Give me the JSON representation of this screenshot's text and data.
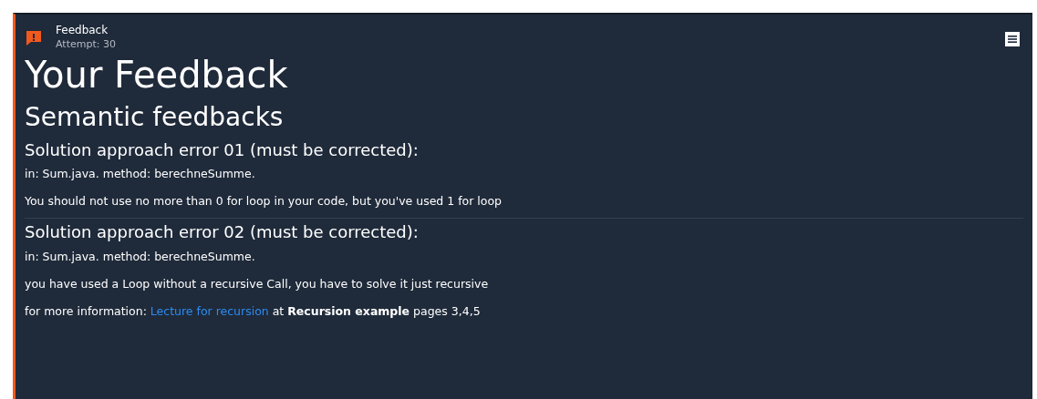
{
  "header": {
    "title": "Feedback",
    "subtitle": "Attempt: 30"
  },
  "heading": "Your Feedback",
  "section": "Semantic feedbacks",
  "errors": [
    {
      "title": "Solution approach error 01 (must be corrected):",
      "lines": [
        "in: Sum.java. method: berechneSumme.",
        "You should not use no more than 0 for loop in your code, but you've used 1 for loop"
      ]
    },
    {
      "title": "Solution approach error 02 (must be corrected):",
      "lines": [
        "in: Sum.java. method: berechneSumme.",
        "you have used a Loop without a recursive Call, you have to solve it just recursive"
      ],
      "info": {
        "before": "for more information: ",
        "link": "Lecture for recursion",
        "after": " at **Recursion example** pages 3,4,5"
      }
    }
  ]
}
